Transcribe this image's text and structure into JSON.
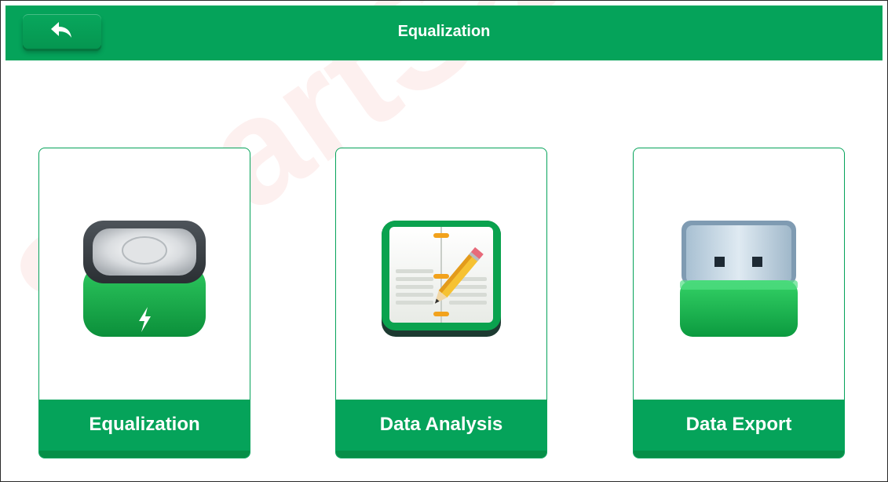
{
  "header": {
    "title": "Equalization",
    "back_icon": "back-arrow-icon"
  },
  "menu": {
    "items": [
      {
        "label": "Equalization",
        "icon": "battery-icon"
      },
      {
        "label": "Data Analysis",
        "icon": "notebook-pencil-icon"
      },
      {
        "label": "Data Export",
        "icon": "usb-drive-icon"
      }
    ]
  },
  "watermark": {
    "text": "SmartSafe"
  },
  "colors": {
    "accent": "#05a35a",
    "accent_dark": "#068f48",
    "background": "#ffffff"
  }
}
